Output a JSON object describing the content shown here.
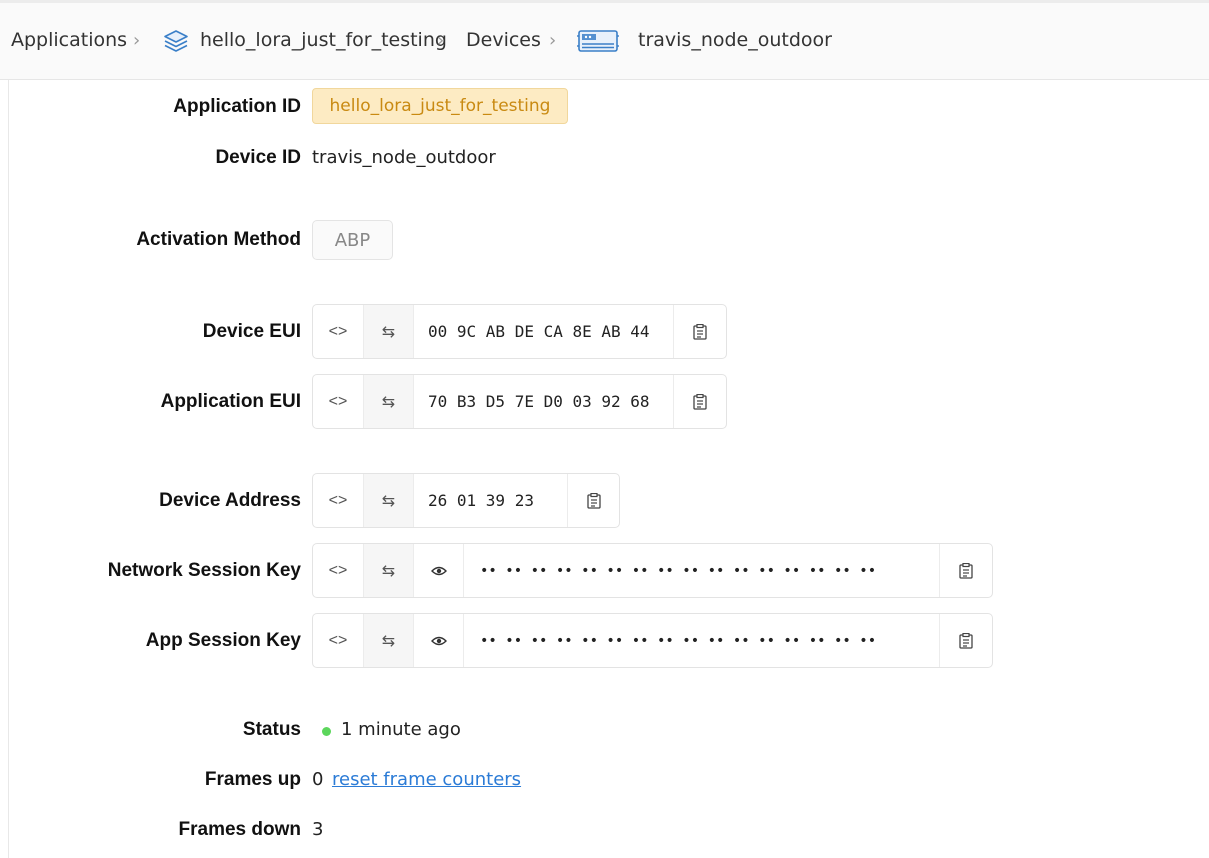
{
  "breadcrumb": {
    "items": [
      {
        "label": "Applications",
        "icon": null
      },
      {
        "label": "hello_lora_just_for_testing",
        "icon": "layers-icon"
      },
      {
        "label": "Devices",
        "icon": null
      },
      {
        "label": "travis_node_outdoor",
        "icon": "device-icon"
      }
    ],
    "separator": ">"
  },
  "fields": {
    "application_id": {
      "label": "Application ID",
      "value": "hello_lora_just_for_testing"
    },
    "device_id": {
      "label": "Device ID",
      "value": "travis_node_outdoor"
    },
    "activation_method": {
      "label": "Activation Method",
      "value": "ABP"
    },
    "device_eui": {
      "label": "Device EUI",
      "value": "00 9C AB DE CA 8E AB 44"
    },
    "application_eui": {
      "label": "Application EUI",
      "value": "70 B3 D5 7E D0 03 92 68"
    },
    "device_address": {
      "label": "Device Address",
      "value": "26 01 39 23"
    },
    "network_session_key": {
      "label": "Network Session Key",
      "value": "•• •• •• •• •• •• •• •• •• •• •• •• •• •• •• ••"
    },
    "app_session_key": {
      "label": "App Session Key",
      "value": "•• •• •• •• •• •• •• •• •• •• •• •• •• •• •• ••"
    },
    "status": {
      "label": "Status",
      "value": "1 minute ago",
      "color": "#5cd65c"
    },
    "frames_up": {
      "label": "Frames up",
      "value": "0",
      "link": "reset frame counters"
    },
    "frames_down": {
      "label": "Frames down",
      "value": "3"
    }
  },
  "icons": {
    "toggle_format": "<>",
    "swap_byte_order": "⇆",
    "show": "eye-icon",
    "copy": "clipboard-icon"
  },
  "colors": {
    "app_id_badge_bg": "#fdebc3",
    "app_id_badge_text": "#c98a12",
    "link": "#2b7bd6"
  }
}
